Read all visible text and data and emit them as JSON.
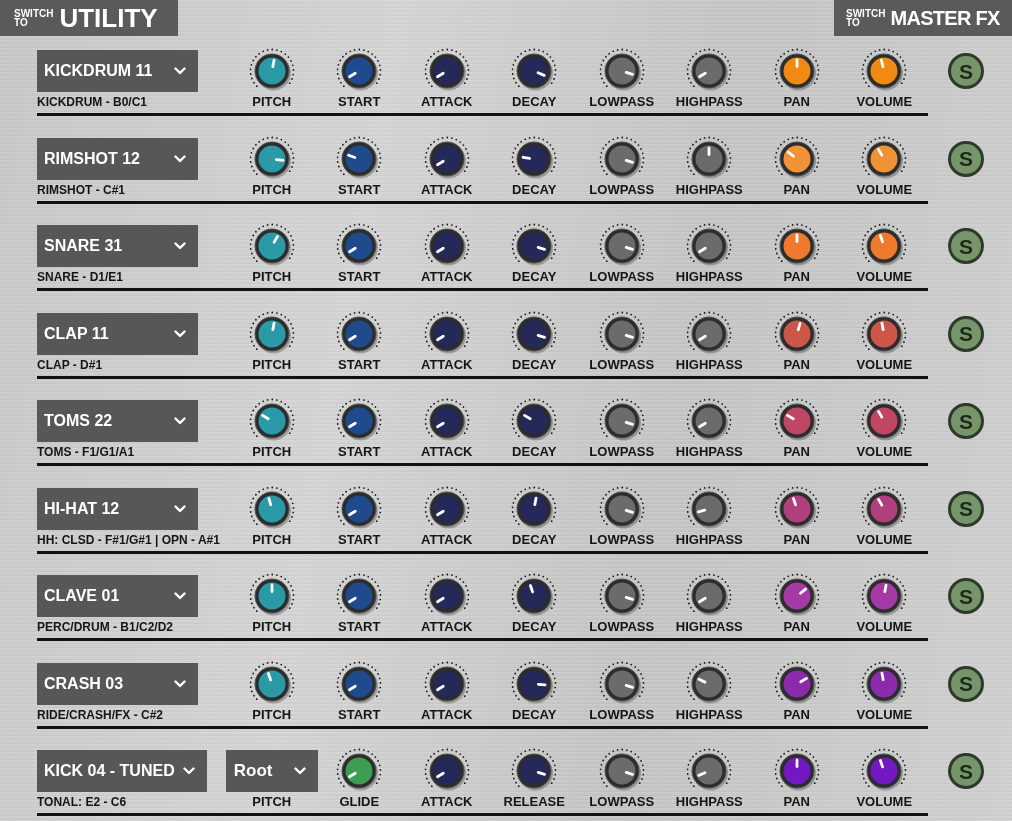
{
  "header": {
    "left_switch": {
      "prefix": "SWITCH TO",
      "label": "UTILITY"
    },
    "right_switch": {
      "prefix": "SWITCH TO",
      "label": "MASTER FX"
    }
  },
  "rows": [
    {
      "preset": "KICKDRUM 11",
      "note_range": "KICKDRUM - B0/C1",
      "controls": [
        {
          "kind": "knob",
          "label": "PITCH",
          "level": 0.54,
          "color": "#2a9ba6"
        },
        {
          "kind": "knob",
          "label": "START",
          "level": 0.05,
          "color": "#1f4b8c"
        },
        {
          "kind": "knob",
          "label": "ATTACK",
          "level": 0.05,
          "color": "#25295a"
        },
        {
          "kind": "knob",
          "label": "DECAY",
          "level": 0.92,
          "color": "#25295a"
        },
        {
          "kind": "knob",
          "label": "LOWPASS",
          "level": 0.9,
          "color": "#6b6b6b"
        },
        {
          "kind": "knob",
          "label": "HIGHPASS",
          "level": 0.05,
          "color": "#6b6b6b"
        },
        {
          "kind": "knob",
          "label": "PAN",
          "level": 0.5,
          "color": "#f08a12"
        },
        {
          "kind": "knob",
          "label": "VOLUME",
          "level": 0.45,
          "color": "#f08a12"
        }
      ],
      "solo": "S"
    },
    {
      "preset": "RIMSHOT 12",
      "note_range": "RIMSHOT - C#1",
      "controls": [
        {
          "kind": "knob",
          "label": "PITCH",
          "level": 0.86,
          "color": "#2a9ba6"
        },
        {
          "kind": "knob",
          "label": "START",
          "level": 0.24,
          "color": "#1f4b8c"
        },
        {
          "kind": "knob",
          "label": "ATTACK",
          "level": 0.05,
          "color": "#25295a"
        },
        {
          "kind": "knob",
          "label": "DECAY",
          "level": 0.2,
          "color": "#25295a"
        },
        {
          "kind": "knob",
          "label": "LOWPASS",
          "level": 0.9,
          "color": "#6b6b6b"
        },
        {
          "kind": "knob",
          "label": "HIGHPASS",
          "level": 0.5,
          "color": "#6b6b6b"
        },
        {
          "kind": "knob",
          "label": "PAN",
          "level": 0.31,
          "color": "#f09238"
        },
        {
          "kind": "knob",
          "label": "VOLUME",
          "level": 0.39,
          "color": "#f09238"
        }
      ],
      "solo": "S"
    },
    {
      "preset": "SNARE 31",
      "note_range": "SNARE - D1/E1",
      "controls": [
        {
          "kind": "knob",
          "label": "PITCH",
          "level": 0.61,
          "color": "#2a9ba6"
        },
        {
          "kind": "knob",
          "label": "START",
          "level": 0.05,
          "color": "#1f4b8c"
        },
        {
          "kind": "knob",
          "label": "ATTACK",
          "level": 0.05,
          "color": "#25295a"
        },
        {
          "kind": "knob",
          "label": "DECAY",
          "level": 0.9,
          "color": "#25295a"
        },
        {
          "kind": "knob",
          "label": "LOWPASS",
          "level": 0.9,
          "color": "#6b6b6b"
        },
        {
          "kind": "knob",
          "label": "HIGHPASS",
          "level": 0.05,
          "color": "#6b6b6b"
        },
        {
          "kind": "knob",
          "label": "PAN",
          "level": 0.5,
          "color": "#ef7a2e"
        },
        {
          "kind": "knob",
          "label": "VOLUME",
          "level": 0.43,
          "color": "#ef7a2e"
        }
      ],
      "solo": "S"
    },
    {
      "preset": "CLAP 11",
      "note_range": "CLAP - D#1",
      "controls": [
        {
          "kind": "knob",
          "label": "PITCH",
          "level": 0.54,
          "color": "#2a9ba6"
        },
        {
          "kind": "knob",
          "label": "START",
          "level": 0.05,
          "color": "#1f4b8c"
        },
        {
          "kind": "knob",
          "label": "ATTACK",
          "level": 0.05,
          "color": "#25295a"
        },
        {
          "kind": "knob",
          "label": "DECAY",
          "level": 0.9,
          "color": "#25295a"
        },
        {
          "kind": "knob",
          "label": "LOWPASS",
          "level": 0.9,
          "color": "#6b6b6b"
        },
        {
          "kind": "knob",
          "label": "HIGHPASS",
          "level": 0.05,
          "color": "#6b6b6b"
        },
        {
          "kind": "knob",
          "label": "PAN",
          "level": 0.56,
          "color": "#cc5648"
        },
        {
          "kind": "knob",
          "label": "VOLUME",
          "level": 0.46,
          "color": "#cc5648"
        }
      ],
      "solo": "S"
    },
    {
      "preset": "TOMS 22",
      "note_range": "TOMS - F1/G1/A1",
      "controls": [
        {
          "kind": "knob",
          "label": "PITCH",
          "level": 0.28,
          "color": "#2a9ba6"
        },
        {
          "kind": "knob",
          "label": "START",
          "level": 0.05,
          "color": "#1f4b8c"
        },
        {
          "kind": "knob",
          "label": "ATTACK",
          "level": 0.05,
          "color": "#25295a"
        },
        {
          "kind": "knob",
          "label": "DECAY",
          "level": 0.28,
          "color": "#25295a"
        },
        {
          "kind": "knob",
          "label": "LOWPASS",
          "level": 0.9,
          "color": "#6b6b6b"
        },
        {
          "kind": "knob",
          "label": "HIGHPASS",
          "level": 0.05,
          "color": "#6b6b6b"
        },
        {
          "kind": "knob",
          "label": "PAN",
          "level": 0.28,
          "color": "#bf4763"
        },
        {
          "kind": "knob",
          "label": "VOLUME",
          "level": 0.39,
          "color": "#bf4763"
        }
      ],
      "solo": "S"
    },
    {
      "preset": "HI-HAT 12",
      "note_range": "HH: CLSD - F#1/G#1 | OPN - A#1",
      "controls": [
        {
          "kind": "knob",
          "label": "PITCH",
          "level": 0.44,
          "color": "#2a9ba6"
        },
        {
          "kind": "knob",
          "label": "START",
          "level": 0.05,
          "color": "#1f4b8c"
        },
        {
          "kind": "knob",
          "label": "ATTACK",
          "level": 0.05,
          "color": "#25295a"
        },
        {
          "kind": "knob",
          "label": "DECAY",
          "level": 0.54,
          "color": "#25295a"
        },
        {
          "kind": "knob",
          "label": "LOWPASS",
          "level": 0.9,
          "color": "#6b6b6b"
        },
        {
          "kind": "knob",
          "label": "HIGHPASS",
          "level": 0.11,
          "color": "#6b6b6b"
        },
        {
          "kind": "knob",
          "label": "PAN",
          "level": 0.43,
          "color": "#b03f7d"
        },
        {
          "kind": "knob",
          "label": "VOLUME",
          "level": 0.39,
          "color": "#b03f7d"
        }
      ],
      "solo": "S"
    },
    {
      "preset": "CLAVE 01",
      "note_range": "PERC/DRUM - B1/C2/D2",
      "controls": [
        {
          "kind": "knob",
          "label": "PITCH",
          "level": 0.5,
          "color": "#2a9ba6"
        },
        {
          "kind": "knob",
          "label": "START",
          "level": 0.05,
          "color": "#1f4b8c"
        },
        {
          "kind": "knob",
          "label": "ATTACK",
          "level": 0.05,
          "color": "#25295a"
        },
        {
          "kind": "knob",
          "label": "DECAY",
          "level": 0.43,
          "color": "#25295a"
        },
        {
          "kind": "knob",
          "label": "LOWPASS",
          "level": 0.9,
          "color": "#6b6b6b"
        },
        {
          "kind": "knob",
          "label": "HIGHPASS",
          "level": 0.05,
          "color": "#6b6b6b"
        },
        {
          "kind": "knob",
          "label": "PAN",
          "level": 0.69,
          "color": "#a43aa6"
        },
        {
          "kind": "knob",
          "label": "VOLUME",
          "level": 0.54,
          "color": "#a43aa6"
        }
      ],
      "solo": "S"
    },
    {
      "preset": "CRASH 03",
      "note_range": "RIDE/CRASH/FX - C#2",
      "controls": [
        {
          "kind": "knob",
          "label": "PITCH",
          "level": 0.43,
          "color": "#2a9ba6"
        },
        {
          "kind": "knob",
          "label": "START",
          "level": 0.05,
          "color": "#1f4b8c"
        },
        {
          "kind": "knob",
          "label": "ATTACK",
          "level": 0.05,
          "color": "#25295a"
        },
        {
          "kind": "knob",
          "label": "DECAY",
          "level": 0.85,
          "color": "#25295a"
        },
        {
          "kind": "knob",
          "label": "LOWPASS",
          "level": 0.9,
          "color": "#6b6b6b"
        },
        {
          "kind": "knob",
          "label": "HIGHPASS",
          "level": 0.26,
          "color": "#6b6b6b"
        },
        {
          "kind": "knob",
          "label": "PAN",
          "level": 0.72,
          "color": "#8c2aae"
        },
        {
          "kind": "knob",
          "label": "VOLUME",
          "level": 0.46,
          "color": "#8c2aae"
        }
      ],
      "solo": "S"
    },
    {
      "preset": "KICK 04 - TUNED",
      "note_range": "TONAL: E2 - C6",
      "controls": [
        {
          "kind": "dropdown",
          "label": "PITCH",
          "value": "Root"
        },
        {
          "kind": "knob",
          "label": "GLIDE",
          "level": 0.05,
          "color": "#3d9e52"
        },
        {
          "kind": "knob",
          "label": "ATTACK",
          "level": 0.05,
          "color": "#25295a"
        },
        {
          "kind": "knob",
          "label": "RELEASE",
          "level": 0.9,
          "color": "#25295a"
        },
        {
          "kind": "knob",
          "label": "LOWPASS",
          "level": 0.9,
          "color": "#6b6b6b"
        },
        {
          "kind": "knob",
          "label": "HIGHPASS",
          "level": 0.08,
          "color": "#6b6b6b"
        },
        {
          "kind": "knob",
          "label": "PAN",
          "level": 0.5,
          "color": "#7219c4"
        },
        {
          "kind": "knob",
          "label": "VOLUME",
          "level": 0.43,
          "color": "#7219c4"
        }
      ],
      "solo": "S"
    }
  ]
}
